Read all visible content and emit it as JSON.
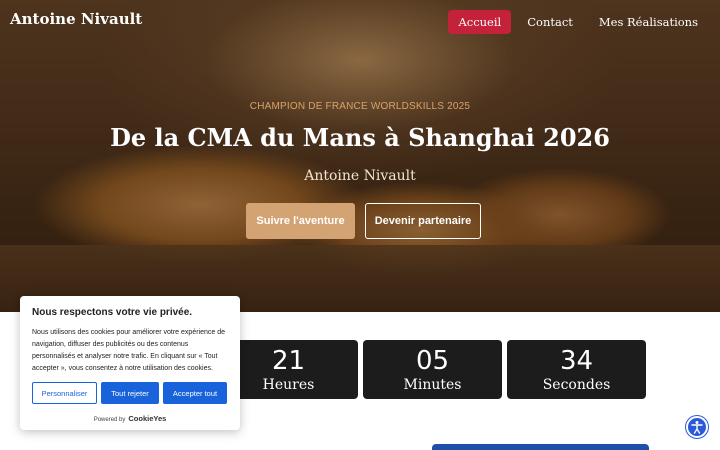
{
  "header": {
    "brand": "Antoine Nivault",
    "nav": [
      {
        "label": "Accueil",
        "active": true
      },
      {
        "label": "Contact",
        "active": false
      },
      {
        "label": "Mes Réalisations",
        "active": false
      }
    ]
  },
  "hero": {
    "kicker": "CHAMPION DE FRANCE WORLDSKILLS 2025",
    "title": "De la CMA du Mans à Shanghai 2026",
    "subtitle": "Antoine Nivault",
    "primary_button": "Suivre l'aventure",
    "secondary_button": "Devenir partenaire"
  },
  "countdown": [
    {
      "value": "21",
      "unit": "Heures"
    },
    {
      "value": "05",
      "unit": "Minutes"
    },
    {
      "value": "34",
      "unit": "Secondes"
    }
  ],
  "cookie_banner": {
    "title": "Nous respectons votre vie privée.",
    "text": "Nous utilisons des cookies pour améliorer votre expérience de navigation, diffuser des publicités ou des contenus personnalisés et analyser notre trafic. En cliquant sur « Tout accepter », vous consentez à notre utilisation des cookies.",
    "customize": "Personnaliser",
    "reject": "Tout rejeter",
    "accept": "Accepter tout",
    "powered_by": "Powered by",
    "logo": "CookieYes"
  },
  "colors": {
    "accent_red": "#c4213a",
    "gold": "#d4a373",
    "cookie_blue": "#1863dc",
    "countdown_bg": "#1c1c1c"
  },
  "icons": {
    "accessibility": "accessibility-icon"
  }
}
